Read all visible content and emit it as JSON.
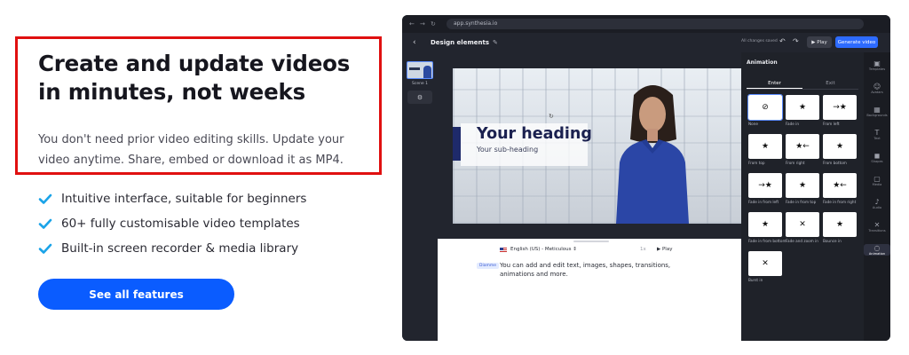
{
  "hero": {
    "headline": "Create and update videos in minutes, not weeks",
    "lede": "You don't need prior video editing skills. Update your video anytime. Share, embed or download it as MP4.",
    "features": [
      "Intuitive interface, suitable for beginners",
      "60+ fully customisable video templates",
      "Built-in screen recorder & media library"
    ],
    "cta_label": "See all features",
    "colors": {
      "accent": "#0a5cff",
      "check": "#1aa3e8",
      "highlight_border": "#e01010"
    }
  },
  "app": {
    "url": "app.synthesia.io",
    "header": {
      "title": "Design elements",
      "saved": "All changes saved",
      "play": "Play",
      "generate": "Generate video"
    },
    "scenes": {
      "first_label": "Scene 1"
    },
    "slide": {
      "heading": "Your heading",
      "subheading": "Your sub-heading"
    },
    "script": {
      "voice": "English (US) - Meticulous",
      "speed": "1x",
      "play": "Play",
      "tag": "Diamme",
      "text": "You can add and edit text, images, shapes, transitions, animations and more."
    },
    "animation": {
      "title": "Animation",
      "tabs": [
        "Enter",
        "Exit"
      ],
      "items": [
        {
          "label": "None",
          "icon": "⊘"
        },
        {
          "label": "Fade in",
          "icon": "★"
        },
        {
          "label": "From left",
          "icon": "→★"
        },
        {
          "label": "From top",
          "icon": "★"
        },
        {
          "label": "From right",
          "icon": "★←"
        },
        {
          "label": "From bottom",
          "icon": "★"
        },
        {
          "label": "Fade in from left",
          "icon": "→★"
        },
        {
          "label": "Fade in from top",
          "icon": "★"
        },
        {
          "label": "Fade in from right",
          "icon": "★←"
        },
        {
          "label": "Fade in from bottom",
          "icon": "★"
        },
        {
          "label": "Fade and zoom in",
          "icon": "✕"
        },
        {
          "label": "Bounce in",
          "icon": "★"
        },
        {
          "label": "Burst in",
          "icon": "✕"
        }
      ]
    },
    "rail": [
      {
        "label": "Templates",
        "icon": "▣"
      },
      {
        "label": "Avatars",
        "icon": "☺"
      },
      {
        "label": "Backgrounds",
        "icon": "▦"
      },
      {
        "label": "Text",
        "icon": "T"
      },
      {
        "label": "Shapes",
        "icon": "◼"
      },
      {
        "label": "Media",
        "icon": "▢"
      },
      {
        "label": "Audio",
        "icon": "♪"
      },
      {
        "label": "Transitions",
        "icon": "✕"
      },
      {
        "label": "Animation",
        "icon": "◌"
      }
    ]
  }
}
